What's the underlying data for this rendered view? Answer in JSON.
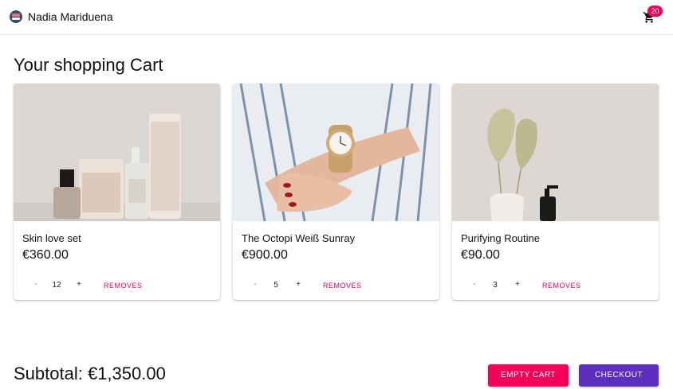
{
  "app": {
    "brand": "Nadia Mariduena",
    "cart_count": "20"
  },
  "colors": {
    "accent_pink": "#f50057",
    "primary_purple": "#5d2fbf"
  },
  "page": {
    "title": "Your shopping Cart"
  },
  "cart": {
    "items": [
      {
        "name": "Skin love set",
        "price": "€360.00",
        "quantity": "12",
        "minus": "-",
        "plus": "+",
        "remove_label": "REMOVES",
        "image": "skincare-products-photo"
      },
      {
        "name": "The Octopi Weiß Sunray",
        "price": "€900.00",
        "quantity": "5",
        "minus": "-",
        "plus": "+",
        "remove_label": "REMOVES",
        "image": "wrist-watch-photo"
      },
      {
        "name": "Purifying Routine",
        "price": "€90.00",
        "quantity": "3",
        "minus": "-",
        "plus": "+",
        "remove_label": "REMOVES",
        "image": "dried-palm-vase-photo"
      }
    ]
  },
  "footer": {
    "subtotal": "Subtotal: €1,350.00",
    "empty_label": "EMPTY CART",
    "checkout_label": "CHECKOUT"
  }
}
